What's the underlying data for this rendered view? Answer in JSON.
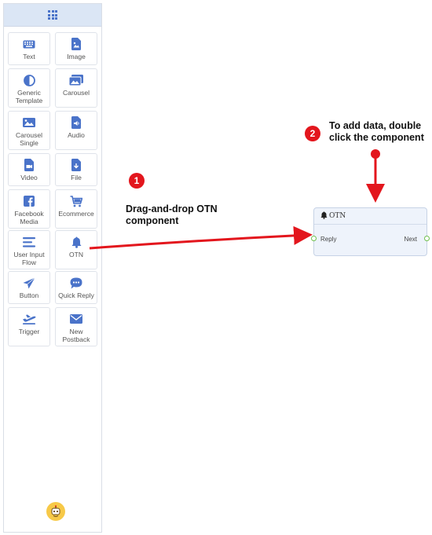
{
  "sidebar": {
    "header_icon": "grid-icon",
    "tiles": [
      {
        "label": "Text",
        "icon": "keyboard-icon"
      },
      {
        "label": "Image",
        "icon": "image-file-icon"
      },
      {
        "label": "Generic\nTemplate",
        "icon": "half-circle-icon"
      },
      {
        "label": "Carousel",
        "icon": "gallery-icon"
      },
      {
        "label": "Carousel\nSingle",
        "icon": "picture-icon"
      },
      {
        "label": "Audio",
        "icon": "audio-file-icon"
      },
      {
        "label": "Video",
        "icon": "video-file-icon"
      },
      {
        "label": "File",
        "icon": "download-file-icon"
      },
      {
        "label": "Facebook\nMedia",
        "icon": "facebook-icon"
      },
      {
        "label": "Ecommerce",
        "icon": "cart-icon"
      },
      {
        "label": "User Input\nFlow",
        "icon": "lines-icon"
      },
      {
        "label": "OTN",
        "icon": "bell-icon"
      },
      {
        "label": "Button",
        "icon": "send-icon"
      },
      {
        "label": "Quick Reply",
        "icon": "chat-icon"
      },
      {
        "label": "Trigger",
        "icon": "plane-icon"
      },
      {
        "label": "New\nPostback",
        "icon": "envelope-icon"
      }
    ],
    "avatar_icon": "bot-avatar-icon"
  },
  "annotations": {
    "step1_number": "1",
    "step1_text": "Drag-and-drop OTN\ncomponent",
    "step2_number": "2",
    "step2_text": "To add data, double\nclick the component"
  },
  "node": {
    "title": "OTN",
    "input_label": "Reply",
    "output_label": "Next"
  },
  "colors": {
    "accent": "#4a73c9",
    "arrow": "#e3161d",
    "port": "#6fbf4e",
    "node_bg": "#eef3fb"
  }
}
